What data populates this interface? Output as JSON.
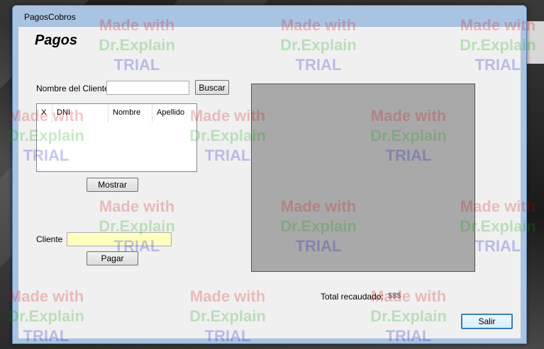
{
  "window": {
    "title": "PagosCobros"
  },
  "form": {
    "heading": "Pagos",
    "client_name_label": "Nombre del Cliente",
    "client_name_value": "",
    "search_button": "Buscar",
    "grid_columns": [
      "X",
      "DNI",
      "Nombre",
      "Apellido"
    ],
    "show_button": "Mostrar",
    "client_label": "Cliente",
    "client_value": "",
    "pay_button": "Pagar",
    "total_label": "Total recaudado:",
    "total_value": "$$$",
    "exit_button": "Salir"
  },
  "watermark": {
    "line1": "Made with",
    "line2": "Dr.Explain",
    "line3": "TRIAL"
  },
  "colors": {
    "client_field_bg": "#ffffc0",
    "picture_bg": "#a9a9a9",
    "titlebar": "#a9c3e2"
  }
}
